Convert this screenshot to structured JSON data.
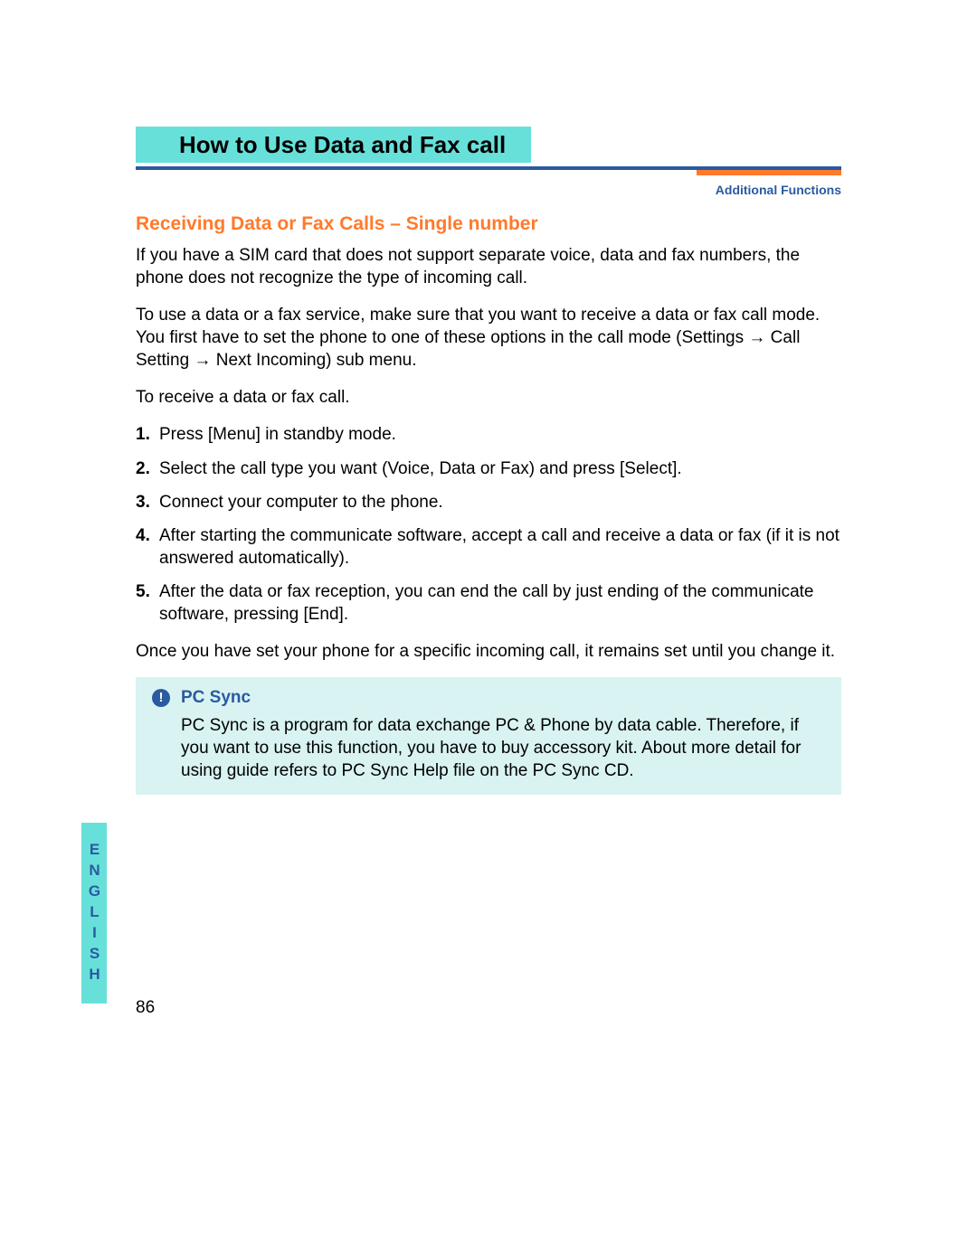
{
  "title": "How to Use Data and Fax call",
  "breadcrumb": "Additional Functions",
  "section_title": "Receiving Data or Fax Calls – Single number",
  "para1": "If you have a SIM card that does not support separate voice, data and fax numbers, the phone does not recognize the type of incoming call.",
  "para2_a": "To use a data or a fax service, make sure that you want to receive a data or fax call mode. You first have to set the phone to one of these options in the call mode (Settings ",
  "para2_b": " Call Setting ",
  "para2_c": " Next Incoming) sub menu.",
  "para3": "To receive a data or fax call.",
  "steps": {
    "n1": "1.",
    "s1": "Press [Menu] in standby mode.",
    "n2": "2.",
    "s2": "Select the call type you want (Voice, Data or Fax) and press [Select].",
    "n3": "3.",
    "s3": "Connect your computer to the phone.",
    "n4": "4.",
    "s4": "After starting the communicate software, accept a call and receive a data or fax (if it is not answered automatically).",
    "n5": "5.",
    "s5": "After the data or fax reception, you can end the call by just ending of the communicate software, pressing [End]."
  },
  "para4": "Once you have set your phone for a specific incoming call, it remains set until you change it.",
  "note": {
    "icon": "!",
    "title": "PC Sync",
    "body": "PC Sync is a program for data exchange PC & Phone by data cable. Therefore, if you want to use this function, you have to buy accessory kit. About more detail for using guide refers to PC Sync Help file on the PC Sync CD."
  },
  "side_label": "ENGLISH",
  "page_number": "86",
  "arrow": "→"
}
